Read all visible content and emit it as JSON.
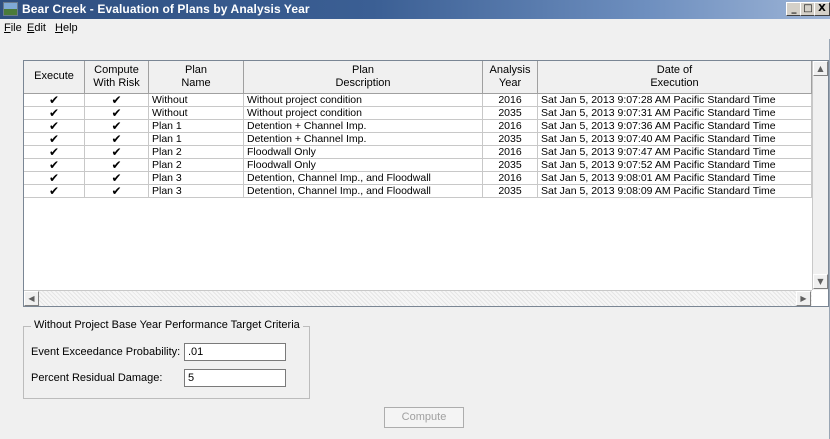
{
  "window": {
    "title": "Bear Creek - Evaluation of Plans by Analysis Year"
  },
  "titlebar_buttons": [
    {
      "glyph": "_",
      "name": "minimize-button"
    },
    {
      "glyph": "□",
      "name": "maximize-button"
    },
    {
      "glyph": "X",
      "name": "close-button"
    }
  ],
  "menu": {
    "file": {
      "accel": "F",
      "rest": "ile"
    },
    "edit": {
      "accel": "E",
      "rest": "dit"
    },
    "help": {
      "accel": "H",
      "rest": "elp"
    }
  },
  "grid": {
    "headers": {
      "execute": "Execute",
      "compute_line1": "Compute",
      "compute_line2": "With Risk",
      "plan_line1": "Plan",
      "plan_line2": "Name",
      "desc_line1": "Plan",
      "desc_line2": "Description",
      "year_line1": "Analysis",
      "year_line2": "Year",
      "date_line1": "Date of",
      "date_line2": "Execution"
    },
    "check_glyph": "✔",
    "rows": [
      {
        "execute": true,
        "compute_with_risk": true,
        "plan_name": "Without",
        "description": "Without project condition",
        "analysis_year": "2016",
        "date_of_execution": "Sat Jan 5, 2013 9:07:28 AM Pacific Standard Time"
      },
      {
        "execute": true,
        "compute_with_risk": true,
        "plan_name": "Without",
        "description": "Without project condition",
        "analysis_year": "2035",
        "date_of_execution": "Sat Jan 5, 2013 9:07:31 AM Pacific Standard Time"
      },
      {
        "execute": true,
        "compute_with_risk": true,
        "plan_name": "Plan 1",
        "description": "Detention + Channel Imp.",
        "analysis_year": "2016",
        "date_of_execution": "Sat Jan 5, 2013 9:07:36 AM Pacific Standard Time"
      },
      {
        "execute": true,
        "compute_with_risk": true,
        "plan_name": "Plan 1",
        "description": "Detention + Channel Imp.",
        "analysis_year": "2035",
        "date_of_execution": "Sat Jan 5, 2013 9:07:40 AM Pacific Standard Time"
      },
      {
        "execute": true,
        "compute_with_risk": true,
        "plan_name": "Plan 2",
        "description": "Floodwall Only",
        "analysis_year": "2016",
        "date_of_execution": "Sat Jan 5, 2013 9:07:47 AM Pacific Standard Time"
      },
      {
        "execute": true,
        "compute_with_risk": true,
        "plan_name": "Plan 2",
        "description": "Floodwall Only",
        "analysis_year": "2035",
        "date_of_execution": "Sat Jan 5, 2013 9:07:52 AM Pacific Standard Time"
      },
      {
        "execute": true,
        "compute_with_risk": true,
        "plan_name": "Plan 3",
        "description": "Detention, Channel Imp., and Floodwall",
        "analysis_year": "2016",
        "date_of_execution": "Sat Jan 5, 2013 9:08:01 AM Pacific Standard Time"
      },
      {
        "execute": true,
        "compute_with_risk": true,
        "plan_name": "Plan 3",
        "description": "Detention, Channel Imp., and Floodwall",
        "analysis_year": "2035",
        "date_of_execution": "Sat Jan 5, 2013 9:08:09 AM Pacific Standard Time"
      }
    ]
  },
  "scroll_glyphs": {
    "up": "▲",
    "down": "▼",
    "left": "◀",
    "right": "▶"
  },
  "criteria": {
    "title": "Without Project Base Year Performance Target Criteria",
    "event_label": "Event Exceedance Probability:",
    "event_value": ".01",
    "damage_label": "Percent Residual Damage:",
    "damage_value": "5"
  },
  "compute_button": {
    "label": "Compute",
    "enabled": false
  }
}
